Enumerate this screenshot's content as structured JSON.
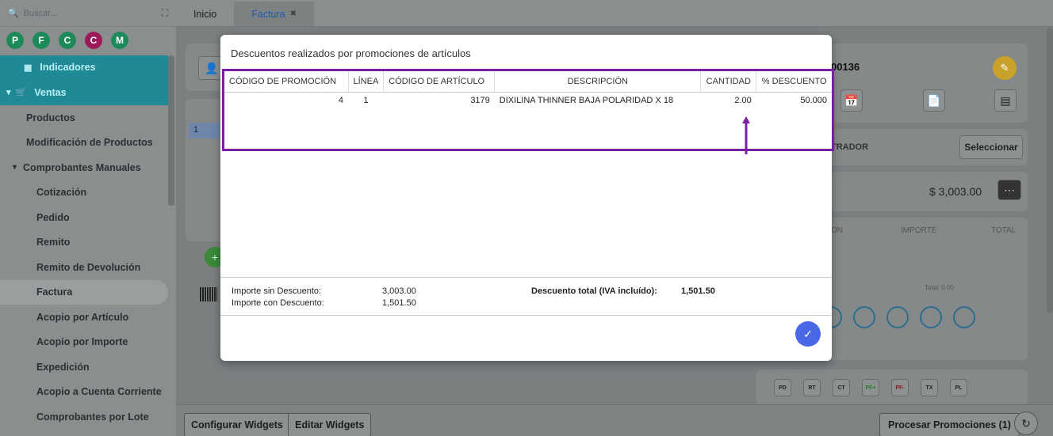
{
  "sidebar": {
    "search_placeholder": "Buscar...",
    "shortcuts": [
      {
        "label": "P",
        "color": "#1e8a5a"
      },
      {
        "label": "F",
        "color": "#1e8a5a"
      },
      {
        "label": "C",
        "color": "#1e8a5a"
      },
      {
        "label": "C",
        "color": "#9c1a5a"
      },
      {
        "label": "M",
        "color": "#1e8a5a"
      }
    ],
    "menu": {
      "indicadores": "Indicadores",
      "ventas": "Ventas",
      "productos": "Productos",
      "modificacion": "Modificación de Productos",
      "comprobantes_manuales": "Comprobantes Manuales",
      "cotizacion": "Cotización",
      "pedido": "Pedido",
      "remito": "Remito",
      "remito_devolucion": "Remito de Devolución",
      "factura": "Factura",
      "acopio_articulo": "Acopio por Artículo",
      "acopio_importe": "Acopio por Importe",
      "expedicion": "Expedición",
      "acopio_cc": "Acopio a Cuenta Corriente",
      "comprobantes_lote": "Comprobantes por Lote"
    }
  },
  "tabs": {
    "inicio": "Inicio",
    "factura": "Factura"
  },
  "background": {
    "doc_number": "00136",
    "trador": "TRADOR",
    "seleccionar": "Seleccionar",
    "amount": "$ 3,003.00",
    "col_on": "ON",
    "col_importe": "IMPORTE",
    "col_total": "TOTAL",
    "total_label": "Total: 0.00",
    "row_number": "1",
    "file_buttons": [
      "PD",
      "RT",
      "CT",
      "PF+",
      "PF-",
      "TX",
      "PL"
    ]
  },
  "bottom": {
    "configurar": "Configurar Widgets",
    "editar": "Editar Widgets",
    "procesar": "Procesar Promociones (1)"
  },
  "modal": {
    "title": "Descuentos realizados por promociones de artículos",
    "columns": [
      "Código de promoción",
      "Línea",
      "Código de artículo",
      "Descripción",
      "Cantidad",
      "% Descuento"
    ],
    "rows": [
      {
        "codigo_promocion": "4",
        "linea": "1",
        "codigo_articulo": "3179",
        "descripcion": "DIXILINA THINNER BAJA POLARIDAD X 18",
        "cantidad": "2.00",
        "descuento": "50.000"
      }
    ],
    "importe_sin_label": "Importe sin Descuento:",
    "importe_sin_value": "3,003.00",
    "importe_con_label": "Importe con Descuento:",
    "importe_con_value": "1,501.50",
    "descuento_total_label": "Descuento total (IVA incluído):",
    "descuento_total_value": "1,501.50"
  },
  "colors": {
    "accent": "#1f8a96",
    "highlight": "#7a1fa6",
    "ok_button": "#4a67e8"
  }
}
